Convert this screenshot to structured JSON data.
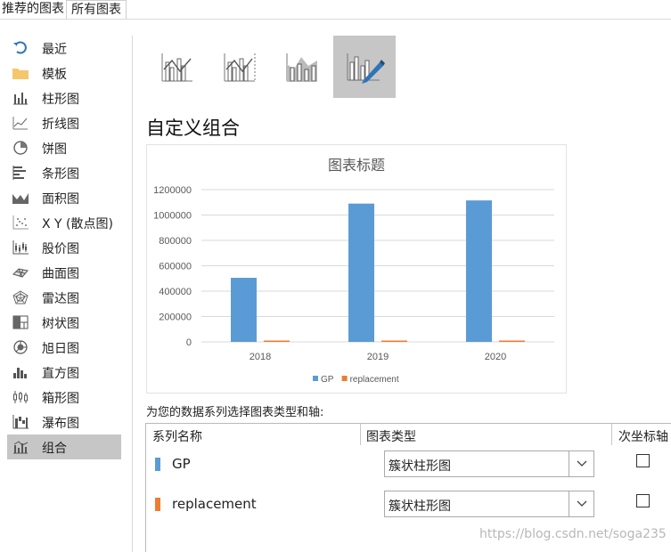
{
  "tabs": [
    {
      "label": "推荐的图表"
    },
    {
      "label": "所有图表"
    }
  ],
  "sidebar": {
    "items": [
      {
        "label": "最近",
        "icon": "undo-icon"
      },
      {
        "label": "模板",
        "icon": "folder-icon"
      },
      {
        "label": "柱形图",
        "icon": "column-chart-icon"
      },
      {
        "label": "折线图",
        "icon": "line-chart-icon"
      },
      {
        "label": "饼图",
        "icon": "pie-chart-icon"
      },
      {
        "label": "条形图",
        "icon": "bar-chart-icon"
      },
      {
        "label": "面积图",
        "icon": "area-chart-icon"
      },
      {
        "label": "X Y (散点图)",
        "icon": "scatter-chart-icon"
      },
      {
        "label": "股价图",
        "icon": "stock-chart-icon"
      },
      {
        "label": "曲面图",
        "icon": "surface-chart-icon"
      },
      {
        "label": "雷达图",
        "icon": "radar-chart-icon"
      },
      {
        "label": "树状图",
        "icon": "treemap-chart-icon"
      },
      {
        "label": "旭日图",
        "icon": "sunburst-chart-icon"
      },
      {
        "label": "直方图",
        "icon": "histogram-chart-icon"
      },
      {
        "label": "箱形图",
        "icon": "box-whisker-chart-icon"
      },
      {
        "label": "瀑布图",
        "icon": "waterfall-chart-icon"
      },
      {
        "label": "组合",
        "icon": "combo-chart-icon",
        "selected": true
      }
    ]
  },
  "combo_types": [
    {
      "icon": "clustered-column-line-icon"
    },
    {
      "icon": "clustered-column-line-secondary-axis-icon"
    },
    {
      "icon": "stacked-area-clustered-column-icon"
    },
    {
      "icon": "custom-combination-icon",
      "selected": true
    }
  ],
  "section_title": "自定义组合",
  "chart_data": {
    "type": "bar",
    "title": "图表标题",
    "categories": [
      "2018",
      "2019",
      "2020"
    ],
    "series": [
      {
        "name": "GP",
        "values": [
          505000,
          1090000,
          1115000
        ],
        "color": "#5b9bd5"
      },
      {
        "name": "replacement",
        "values": [
          8000,
          8000,
          8000
        ],
        "color": "#ed7d31"
      }
    ],
    "ylim": [
      0,
      1200000
    ],
    "yticks": [
      "0",
      "200000",
      "400000",
      "600000",
      "800000",
      "1000000",
      "1200000"
    ],
    "grid": true,
    "legend": "bottom"
  },
  "instruction": "为您的数据系列选择图表类型和轴:",
  "table": {
    "headers": {
      "name": "系列名称",
      "type": "图表类型",
      "axis": "次坐标轴"
    },
    "rows": [
      {
        "name": "GP",
        "color": "#5b9bd5",
        "type": "簇状柱形图",
        "secondary": false
      },
      {
        "name": "replacement",
        "color": "#ed7d31",
        "type": "簇状柱形图",
        "secondary": false
      }
    ]
  },
  "watermark": "https://blog.csdn.net/soga235"
}
